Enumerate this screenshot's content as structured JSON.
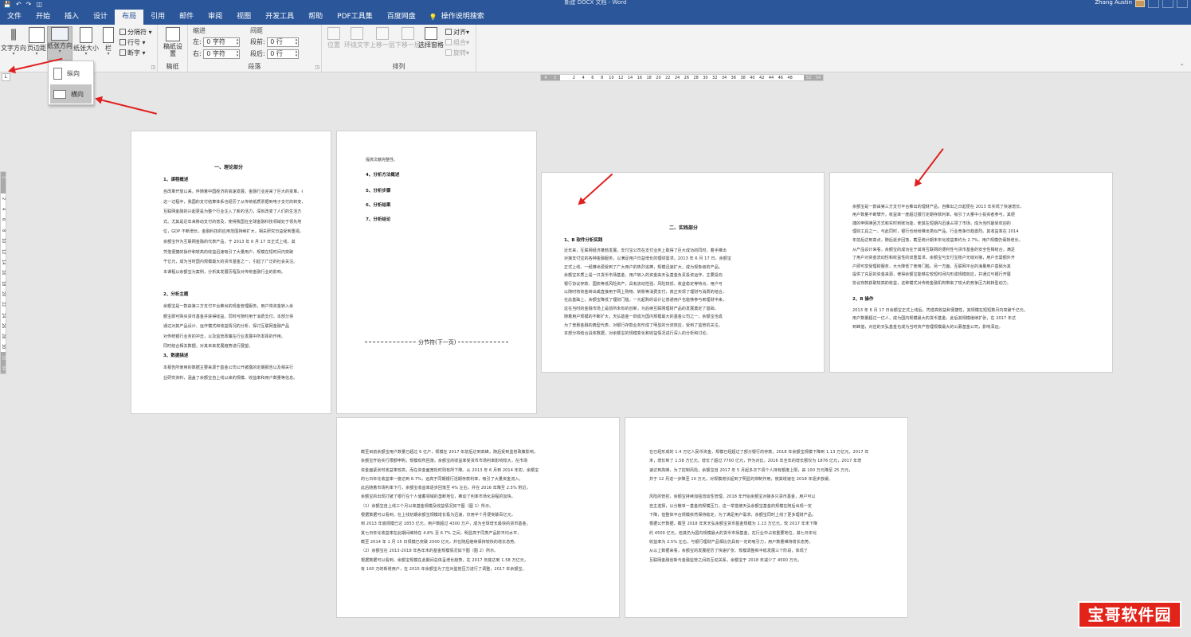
{
  "window": {
    "quick_access": [
      "💾",
      "↶",
      "↷",
      "◫"
    ],
    "doc_title": "新建 DOCX 文档 - Word",
    "user_name": "Zhang Austin"
  },
  "tabs": [
    "文件",
    "开始",
    "插入",
    "设计",
    "布局",
    "引用",
    "邮件",
    "审阅",
    "视图",
    "开发工具",
    "帮助",
    "PDF工具集",
    "百度网盘"
  ],
  "active_tab": "布局",
  "tell_me": {
    "icon": "lightbulb-icon",
    "label": "操作说明搜索"
  },
  "ribbon": {
    "page_setup": {
      "text_direction": "文字方向",
      "margins": "页边距",
      "orientation": "纸张方向",
      "size": "纸张大小",
      "columns": "栏",
      "breaks": "分隔符",
      "line_numbers": "行号",
      "hyphenation": "断字"
    },
    "draft": {
      "button": "稿纸设置",
      "group": "稿纸"
    },
    "indent": {
      "header": "缩进",
      "left_label": "左:",
      "left_value": "0 字符",
      "right_label": "右:",
      "right_value": "0 字符"
    },
    "spacing": {
      "header": "间距",
      "before_label": "段前:",
      "before_value": "0 行",
      "after_label": "段后:",
      "after_value": "0 行"
    },
    "paragraph_group": "段落",
    "arrange": {
      "position": "位置",
      "wrap_text": "环绕文字",
      "bring_forward": "上移一层",
      "send_backward": "下移一层",
      "selection_pane": "选择窗格",
      "align": "对齐",
      "group": "组合",
      "rotate": "旋转",
      "group_label": "排列"
    }
  },
  "orientation_menu": {
    "portrait": "纵向",
    "landscape": "横向"
  },
  "ruler": {
    "horizontal": [
      "4",
      "2",
      "",
      "2",
      "4",
      "6",
      "8",
      "10",
      "12",
      "14",
      "16",
      "18",
      "20",
      "22",
      "24",
      "26",
      "28",
      "30",
      "32",
      "34",
      "36",
      "38",
      "40",
      "42",
      "44",
      "46",
      "48",
      "",
      "52",
      "54"
    ],
    "vertical": [
      "2",
      "",
      "2",
      "4",
      "6",
      "8",
      "10",
      "12",
      "14",
      "16",
      "18",
      "20",
      "22",
      "24",
      "26",
      "28",
      "30",
      "32",
      "34"
    ]
  },
  "pages": {
    "page1": {
      "title": "一、理论部分",
      "h_course": "1、课程概述",
      "course_lines": [
        "自改革开放以来，伴随着中国经济的高速发展，金融行业迎来了巨大的变革。在",
        "这一过程中，我国的支付结算体系也经历了从传统纸质票据到电子支付的转变，",
        "互联网金融的兴起更是为整个行业注入了新的活力，深刻改变了人们的生活方",
        "式。尤其是近年来移动支付的普及，使得我国在全球金融科技领域处于领先地",
        "位，GDP 不断增长，金融科技的应用范围持续扩大，相关研究日益受到重视。",
        "余额宝作为互联网金融的代表产品，于 2013 年 6 月 17 日正式上线，其",
        "凭借便捷的操作和较高的收益迅速吸引了大量用户，规模在短时间内突破",
        "千亿元，成为当时国内规模最大的货币基金之一，引起了广泛的社会关注。",
        "本课程以余额宝为案例，分析其发展历程及对传统金融行业的影响。"
      ],
      "h_topic": "2、分析主题",
      "topic_lines": [
        "余额宝是一款由第三方支付平台推出的现金管理服务，用户将资金转入余",
        "额宝即可购买货币基金并获得收益，同时可随时用于消费支付。本部分将",
        "通过对其产品设计、运作模式和收益情况的分析，探讨互联网金融产品",
        "对传统银行业务的冲击，以及监管政策在行业发展中所发挥的作用。",
        "同时结合相关数据，对其未来发展趋势进行展望。"
      ],
      "h_data": "3、数据描述",
      "data_lines": [
        "本报告所使用的数据主要来源于基金公司公开披露的定期报告以及相关行",
        "业研究资料，涵盖了余额宝自上线以来的规模、收益率和用户数量等信息。"
      ]
    },
    "page2": {
      "intro": "提高文献完整性。",
      "items": [
        "4、分析方法概述",
        "5、分析步骤",
        "6、分析结果",
        "7、分析结论"
      ],
      "section_break": "分节符(下一页)"
    },
    "page3": {
      "title": "二、实践部分",
      "h_software": "1、B 软件分析实践",
      "lines": [
        "近年来，互联网经济蓬勃发展，支付宝公司在支付业务上取得了巨大成功的同时，着手推出",
        "对接支付宝的各种金融服务，以满足用户日益增长的理财需求。2013 年 6 月 17 日，余额宝",
        "正式上线，一经推出便受到了广大用户的热烈追捧，规模迅速扩大，成为现象级的产品。",
        "余额宝本质上是一只货币市场基金，用户转入的资金由天弘基金负责投资运作，主要投向",
        "银行协议存款、国债等低风险资产，具有流动性强、风险较低、收益稳定等特点。用户可",
        "以随时将资金转出或直接用于网上购物、转账等消费支付，真正实现了理财与消费的结合。",
        "在此基础上，余额宝降低了理财门槛，一元起购的设计让普通用户也能够参与到理财中来，",
        "这在当时的金融市场上是前所未有的创新，为后续互联网理财产品的发展奠定了基础。",
        "随着用户规模的不断扩大，天弘基金一跃成为国内规模最大的基金公司之一，余额宝也成",
        "为了普惠金融的典型代表，对银行存款业务形成了明显的分流效应，受到了监管的关注。",
        "本部分将结合具体数据，对余额宝的规模变化和收益情况进行深入的分析和讨论。"
      ]
    },
    "page4": {
      "lines_a": [
        "余额宝是一款由第三方支付平台推出的理财产品，自推出之日起便在 2013 年实现了快速增长，",
        "用户数量不断攀升，收益率一度超过银行定期存款利率，吸引了大量中小投资者参与。其便",
        "捷的申购赎回方式和实时到账功能，使其在短期内迅速占领了市场，成为当时最受欢迎的",
        "理财工具之一。与此同时，银行也纷纷推出类似产品，行业竞争日趋激烈。其收益率在 2014",
        "年前后达到高点，随后逐步回落，截至统计期末年化收益率约为 2.7%，用户规模仍保持增长。"
      ],
      "lines_b": [
        "从产品设计来看，余额宝的成功在于其将互联网的便利性与货币基金的安全性相结合，满足",
        "了用户对资金流动性和收益性的双重需求。余额宝与支付宝账户无缝对接，用户无需额外开",
        "户即可享受理财服务，大大降低了使用门槛。另一方面，互联网平台的海量用户基础为其",
        "提供了充足的资金来源，使得余额宝能够在较短时间内形成规模效应，并通过与银行开展",
        "协议存款获取较高的收益，这种模式对传统金融机构带来了较大的竞争压力和转型动力。"
      ],
      "h_ops": "2、B 操作",
      "ops_lines": [
        "2013 年 6 月 17 日余额宝正式上线后，凭借高收益和便捷性，其规模在短短数月内突破千亿元，",
        "用户数量超过一亿人，成为国内规模最大的货币基金。此后其规模继续扩张，在 2017 年达",
        "到峰值，对应的天弘基金也成为当时资产管理规模最大的公募基金公司，影响深远。"
      ]
    },
    "page5": {
      "lines": [
        "截至目前余额宝用户数量已超过 6 亿户，规模在 2017 年前后达到高峰，随后受到监管政策影响，",
        "余额宝开始实行限额申购，规模有所回落。余额宝的收益率受货币市场利率影响较大，在市场",
        "资金面紧张时收益率较高，而在资金面宽松时则有所下降。从 2013 年 6 月到 2014 年初，余额宝",
        "的七日年化收益率一度达到 6.7%，远高于同期银行活期存款利率，吸引了大量资金流入。",
        "此后随着市场利率下行，余额宝收益率逐步回落至 4% 左右，并在 2016 年降至 2.5% 附近。",
        "余额宝的出现打破了银行在个人储蓄领域的垄断地位，推动了利率市场化进程的加快。",
        "（1）余额宝自上线三个月以来基金规模及收益情况如下图（图 1）所示。",
        "根据数据可以看到，在上线初期余额宝规模增长极为迅速，仅用半个月便突破百亿元，",
        "到 2013 年底规模已达 1853 亿元，用户数超过 4300 万户，成为全球增长最快的货币基金。",
        "其七日年化收益率在此期间维持在 4.8% 至 6.7% 之间，明显高于同类产品的平均水平，",
        "截至 2014 年 1 月 15 日规模已突破 2500 亿元，并在随后继续保持较快的增长态势。",
        "（2）余额宝在 2013-2018 年各年末的基金规模情况如下图（图 2）所示。",
        "根据数据可以看到，余额宝规模在此期间总体呈增长趋势，在 2017 年底达到 1.58 万亿元，",
        "有 100 万的新增用户，在 2015 年余额宝为了应对监管压力进行了调整，2017 年余额宝。"
      ]
    },
    "page6": {
      "lines": [
        "在已经形成的 1.4 万亿人民币资金，规模已经超过了部分银行的存款，2018 年余额宝规模下降到 1.13 万亿元，2017 年",
        "末，增长到了 1.58 万亿元，增长了超过 7700 亿元，作为对比，2016 年全年的增长额仅为 1876 亿元，2017 年增",
        "速达到高峰，为了控制风险，余额宝自 2017 年 5 月起多次下调个人持有额度上限，由 100 万元降至 25 万元，",
        "并于 12 月进一步降至 10 万元，对规模增长起到了明显的抑制作用，使其增速在 2018 年逐步放缓。",
        "",
        "风险的管控，余额宝持续加强流动性管理，2018 年开始余额宝对接多只货币基金，用户可以",
        "自主选择，以分散单一基金的规模压力，这一举措使天弘余额宝基金的规模在随后出现一定",
        "下降，但整体平台规模依然保持稳定，为了满足用户需求，余额宝同时上线了更多理财产品。",
        "根据公开数据，截至 2018 年末天弘余额宝货币基金规模为 1.13 万亿元，较 2017 年末下降",
        "约 4500 亿元，但其仍为国内规模最大的货币市场基金，在行业中占有重要地位，其七日年化",
        "收益率为 2.5% 左右，与银行理财产品相比仍具有一定的吸引力，用户数量维持增长态势。",
        "从以上数据来看，余额宝的发展经历了快速扩张、规模调整和平稳发展三个阶段，体现了",
        "互联网金融创新与金融监管之间的互动关系，余额宝于 2018 年减少了 4500 万元。"
      ]
    }
  },
  "watermark": "宝哥软件园"
}
